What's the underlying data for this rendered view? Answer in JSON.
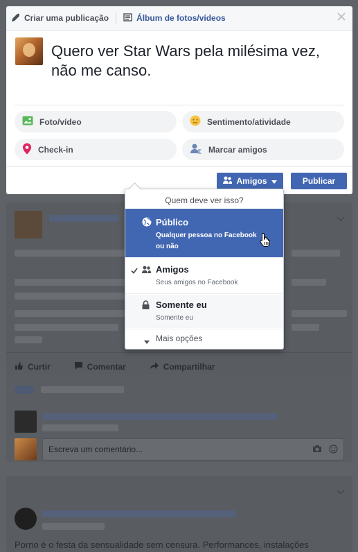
{
  "composer": {
    "tab_create": "Criar uma publicação",
    "tab_album": "Álbum de fotos/vídeos",
    "post_text": "Quero ver Star Wars pela milésima vez, não me canso.",
    "options": [
      {
        "label": "Foto/vídeo",
        "icon": "photo-icon",
        "color": "#5bb75b"
      },
      {
        "label": "Sentimento/atividade",
        "icon": "smiley-icon",
        "color": "#f7c441"
      },
      {
        "label": "Check-in",
        "icon": "location-pin-icon",
        "color": "#e0245e"
      },
      {
        "label": "Marcar amigos",
        "icon": "tag-friends-icon",
        "color": "#6d84b4"
      }
    ],
    "audience_label": "Amigos",
    "publish_label": "Publicar"
  },
  "privacy_menu": {
    "header": "Quem deve ver isso?",
    "options": [
      {
        "title": "Público",
        "subtitle": "Qualquer pessoa no Facebook ou não",
        "icon": "globe-icon"
      },
      {
        "title": "Amigos",
        "subtitle": "Seus amigos no Facebook",
        "icon": "friends-icon"
      },
      {
        "title": "Somente eu",
        "subtitle": "Somente eu",
        "icon": "lock-icon"
      }
    ],
    "more": "Mais opções"
  },
  "feed": {
    "actions": {
      "like": "Curtir",
      "comment": "Comentar",
      "share": "Compartilhar"
    },
    "comment_placeholder": "Escreva um comentário...",
    "second_post_text": "Porno é o festa da sensualidade sem censura. Performances, instalações"
  },
  "colors": {
    "accent": "#4267b2",
    "link": "#365899",
    "overlay": "#5f6266"
  }
}
